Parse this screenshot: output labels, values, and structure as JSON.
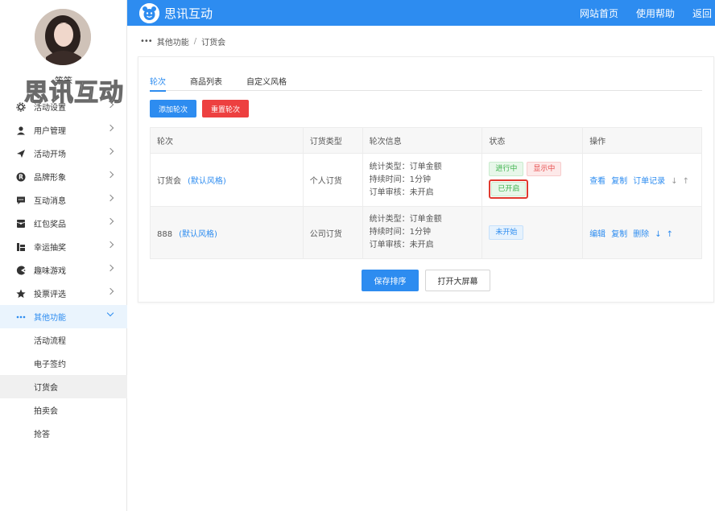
{
  "sidebar": {
    "username": "笨笨",
    "watermark": "思讯互动",
    "items": [
      {
        "label": "活动设置",
        "icon": "gear-icon"
      },
      {
        "label": "用户管理",
        "icon": "user-icon"
      },
      {
        "label": "活动开场",
        "icon": "send-icon"
      },
      {
        "label": "品牌形象",
        "icon": "registered-icon"
      },
      {
        "label": "互动消息",
        "icon": "chat-icon"
      },
      {
        "label": "红包奖品",
        "icon": "gift-icon"
      },
      {
        "label": "幸运抽奖",
        "icon": "lottery-icon"
      },
      {
        "label": "趣味游戏",
        "icon": "pacman-icon"
      },
      {
        "label": "投票评选",
        "icon": "star-icon"
      },
      {
        "label": "其他功能",
        "icon": "more-icon"
      }
    ],
    "subitems": [
      "活动流程",
      "电子签约",
      "订货会",
      "拍卖会",
      "抢答"
    ]
  },
  "topbar": {
    "brand": "思讯互动",
    "links": [
      "网站首页",
      "使用帮助",
      "返回"
    ]
  },
  "breadcrumb": {
    "parent": "其他功能",
    "separator": "/",
    "current": "订货会"
  },
  "tabs": [
    "轮次",
    "商品列表",
    "自定义风格"
  ],
  "buttons": {
    "add": "添加轮次",
    "reset": "重置轮次",
    "save": "保存排序",
    "screen": "打开大屏幕"
  },
  "table": {
    "headers": [
      "轮次",
      "订货类型",
      "轮次信息",
      "状态",
      "操作"
    ],
    "rows": [
      {
        "name": "订货会",
        "style": "(默认风格)",
        "type": "个人订货",
        "info": [
          "统计类型：订单金额",
          "持续时间：1分钟",
          "订单审核：未开启"
        ],
        "tags": [
          "进行中",
          "显示中",
          "已开启"
        ],
        "ops": [
          "查看",
          "复制",
          "订单记录"
        ],
        "arrows": [
          "↓",
          "↑"
        ]
      },
      {
        "name": "888",
        "style": "(默认风格)",
        "type": "公司订货",
        "info": [
          "统计类型：订单金额",
          "持续时间：1分钟",
          "订单审核：未开启"
        ],
        "tags": [
          "未开始"
        ],
        "ops": [
          "编辑",
          "复制",
          "删除"
        ],
        "arrows": [
          "↓",
          "↑"
        ]
      }
    ]
  },
  "colors": {
    "primary": "#2d8cf0",
    "danger": "#ed4040",
    "highlight_box": "#e03a2f"
  }
}
